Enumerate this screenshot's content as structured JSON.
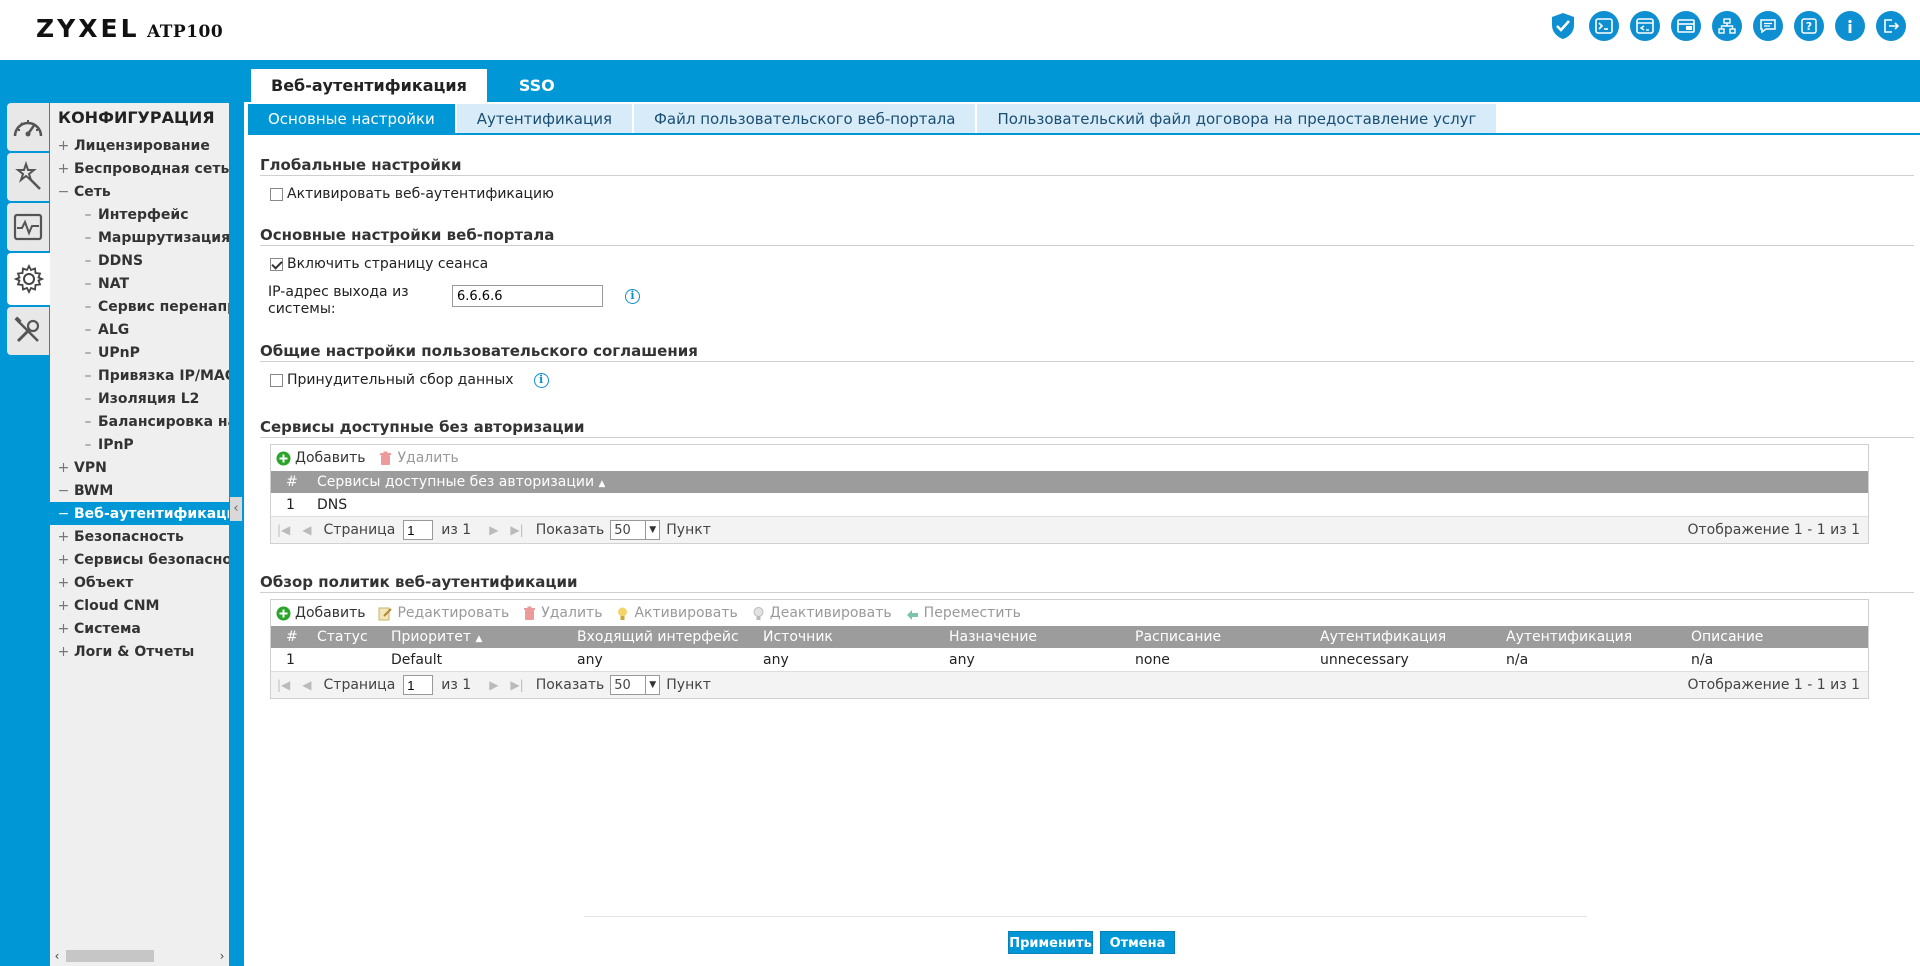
{
  "header": {
    "brand": "ZYXEL",
    "model": "ATP100",
    "icons": [
      "shield-icon",
      "console-icon",
      "cli-icon",
      "window-icon",
      "sitemap-icon",
      "chat-icon",
      "help-icon",
      "info-icon",
      "logout-icon"
    ]
  },
  "top_tabs": [
    {
      "label": "Веб-аутентификация",
      "active": true
    },
    {
      "label": "SSO",
      "active": false
    }
  ],
  "sub_tabs": [
    {
      "label": "Основные настройки",
      "active": true
    },
    {
      "label": "Аутентификация"
    },
    {
      "label": "Файл пользовательского веб-портала"
    },
    {
      "label": "Пользовательский файл договора на предоставление услуг"
    }
  ],
  "sidebar": {
    "title": "КОНФИГУРАЦИЯ",
    "rail": [
      "dashboard-icon",
      "wizard-icon",
      "monitor-icon",
      "configuration-icon",
      "maintenance-icon"
    ],
    "items": [
      {
        "sym": "+",
        "label": "Лицензирование"
      },
      {
        "sym": "+",
        "label": "Беспроводная сеть"
      },
      {
        "sym": "−",
        "label": "Сеть"
      },
      {
        "sym": "–",
        "label": "Интерфейс",
        "sub": true
      },
      {
        "sym": "–",
        "label": "Маршрутизация",
        "sub": true
      },
      {
        "sym": "–",
        "label": "DDNS",
        "sub": true
      },
      {
        "sym": "–",
        "label": "NAT",
        "sub": true
      },
      {
        "sym": "–",
        "label": "Сервис перенапра",
        "sub": true
      },
      {
        "sym": "–",
        "label": "ALG",
        "sub": true
      },
      {
        "sym": "–",
        "label": "UPnP",
        "sub": true
      },
      {
        "sym": "–",
        "label": "Привязка IP/MAC",
        "sub": true
      },
      {
        "sym": "–",
        "label": "Изоляция L2",
        "sub": true
      },
      {
        "sym": "–",
        "label": "Балансировка наг",
        "sub": true
      },
      {
        "sym": "–",
        "label": "IPnP",
        "sub": true
      },
      {
        "sym": "+",
        "label": "VPN"
      },
      {
        "sym": "−",
        "label": "BWM"
      },
      {
        "sym": "−",
        "label": "Веб-аутентификация",
        "active": true
      },
      {
        "sym": "+",
        "label": "Безопасность"
      },
      {
        "sym": "+",
        "label": "Сервисы безопасност"
      },
      {
        "sym": "+",
        "label": "Объект"
      },
      {
        "sym": "+",
        "label": "Cloud CNM"
      },
      {
        "sym": "+",
        "label": "Система"
      },
      {
        "sym": "+",
        "label": "Логи & Отчеты"
      }
    ]
  },
  "global": {
    "title": "Глобальные настройки",
    "enable_label": "Активировать веб-аутентификацию",
    "enable_checked": false
  },
  "portal": {
    "title": "Основные настройки веб-портала",
    "session_label": "Включить страницу сеанса",
    "session_checked": true,
    "ip_label": "IP-адрес выхода из системы:",
    "ip_value": "6.6.6.6"
  },
  "agreement": {
    "title": "Общие настройки пользовательского соглашения",
    "force_label": "Принудительный сбор данных",
    "force_checked": false
  },
  "exempt": {
    "title": "Сервисы доступные без авторизации",
    "toolbar": {
      "add": "Добавить",
      "delete": "Удалить"
    },
    "columns": [
      "#",
      "Сервисы доступные без авторизации"
    ],
    "rows": [
      [
        "1",
        "DNS"
      ]
    ],
    "pager": {
      "page_label": "Страница",
      "page": "1",
      "of": "из 1",
      "show_label": "Показать",
      "per_page": "50",
      "unit": "Пункт",
      "display": "Отображение 1 - 1 из 1"
    }
  },
  "policy": {
    "title": "Обзор политик веб-аутентификации",
    "toolbar": {
      "add": "Добавить",
      "edit": "Редактировать",
      "delete": "Удалить",
      "activate": "Активировать",
      "deactivate": "Деактивировать",
      "move": "Переместить"
    },
    "columns": [
      "#",
      "Статус",
      "Приоритет",
      "Входящий интерфейс",
      "Источник",
      "Назначение",
      "Расписание",
      "Аутентификация",
      "Аутентификация",
      "Описание"
    ],
    "rows": [
      [
        "1",
        "",
        "Default",
        "any",
        "any",
        "any",
        "none",
        "unnecessary",
        "n/a",
        "n/a"
      ]
    ],
    "pager": {
      "page_label": "Страница",
      "page": "1",
      "of": "из 1",
      "show_label": "Показать",
      "per_page": "50",
      "unit": "Пункт",
      "display": "Отображение 1 - 1 из 1"
    }
  },
  "buttons": {
    "apply": "Применить",
    "cancel": "Отмена"
  },
  "colors": {
    "accent": "#0097d6",
    "header_text": "#111111",
    "grid_header": "#9c9c9c",
    "add_green": "#2aa52a",
    "delete_red": "#e06060"
  }
}
